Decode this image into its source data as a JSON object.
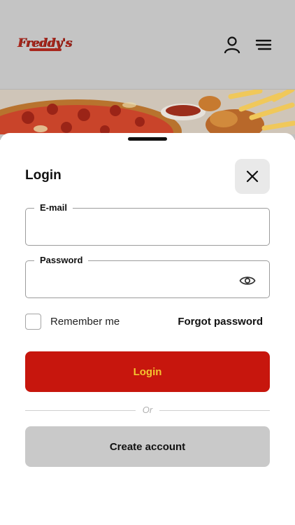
{
  "header": {
    "logo_text": "Freddy's",
    "account_icon": "user-icon",
    "menu_icon": "hamburger-menu-icon"
  },
  "login_sheet": {
    "title": "Login",
    "close_icon": "close-icon",
    "email": {
      "label": "E-mail",
      "value": "",
      "placeholder": ""
    },
    "password": {
      "label": "Password",
      "value": "",
      "placeholder": "",
      "toggle_icon": "eye-icon"
    },
    "remember_me": {
      "label": "Remember me",
      "checked": false
    },
    "forgot_password": "Forgot password",
    "login_button": "Login",
    "divider_text": "Or",
    "create_account_button": "Create account"
  },
  "colors": {
    "brand_red": "#c7160d",
    "login_text": "#f4c430",
    "secondary_button": "#c9c9c9",
    "backdrop": "#c4c4c4"
  }
}
